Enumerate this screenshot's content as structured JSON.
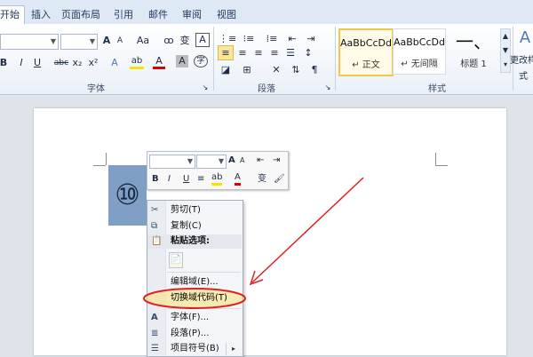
{
  "tabs": [
    {
      "label": "开始",
      "active": true
    },
    {
      "label": "插入"
    },
    {
      "label": "页面布局"
    },
    {
      "label": "引用"
    },
    {
      "label": "邮件"
    },
    {
      "label": "审阅"
    },
    {
      "label": "视图"
    }
  ],
  "ribbon": {
    "font_group_label": "字体",
    "paragraph_group_label": "段落",
    "styles_group_label": "样式",
    "change_styles_label": "更改样式",
    "styles": [
      {
        "sample": "AaBbCcDd",
        "name": "正文"
      },
      {
        "sample": "AaBbCcDd",
        "name": "无间隔"
      },
      {
        "sample": "一、",
        "name": "标题 1"
      }
    ],
    "font_buttons": [
      "A",
      "A",
      "Aa",
      "变",
      "A",
      "B",
      "I",
      "U",
      "abc",
      "x₂",
      "x²",
      "A",
      "ab",
      "A",
      "A",
      "字"
    ],
    "paragraph_buttons": [
      "≡",
      "≡",
      "≡",
      "≡",
      "☰",
      "↕",
      "⇅",
      "A↓",
      "¶"
    ]
  },
  "document": {
    "selected_text": "⑩"
  },
  "mini_toolbar": {
    "buttons": [
      "A",
      "A",
      "B",
      "I",
      "U",
      "≡",
      "ab",
      "A",
      "变"
    ]
  },
  "context_menu": {
    "items": [
      {
        "label": "剪切(T)",
        "icon": "scissors-icon",
        "bold": false
      },
      {
        "label": "复制(C)",
        "icon": "copy-icon",
        "bold": false
      },
      {
        "label": "粘贴选项:",
        "icon": "paste-icon",
        "bold": true
      },
      {
        "label": "编辑域(E)...",
        "icon": "",
        "bold": false
      },
      {
        "label": "切换域代码(T)",
        "icon": "",
        "bold": false,
        "highlighted": true
      },
      {
        "label": "字体(F)...",
        "icon": "font-icon",
        "bold": false
      },
      {
        "label": "段落(P)...",
        "icon": "paragraph-icon",
        "bold": false
      },
      {
        "label": "项目符号(B)",
        "icon": "bullets-icon",
        "bold": false
      }
    ]
  },
  "colors": {
    "annotation_red": "#e02020",
    "highlight_yellow": "#f7e07a",
    "selection_blue": "#7f9fc4"
  }
}
